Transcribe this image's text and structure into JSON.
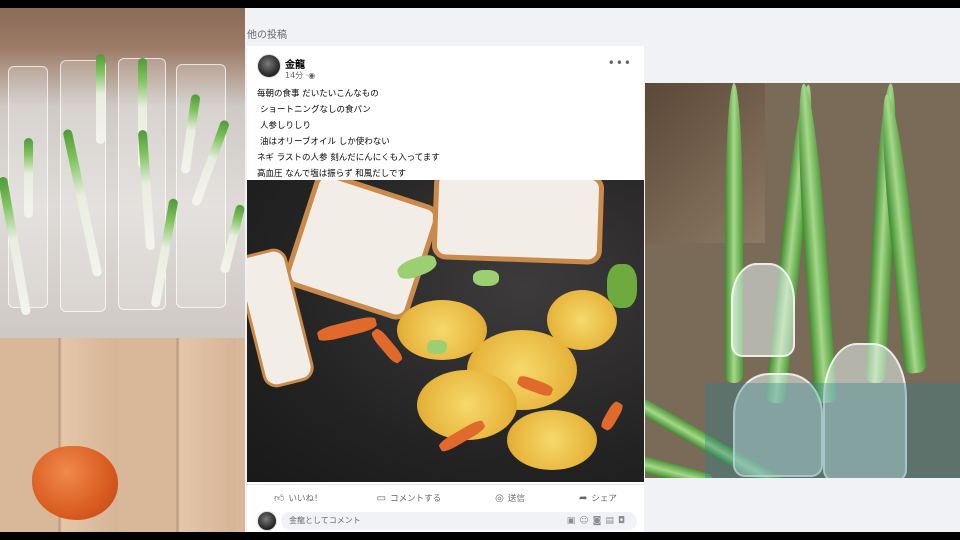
{
  "feed": {
    "section_label": "他の投稿"
  },
  "post": {
    "author": "金龍",
    "time": "14分",
    "privacy_icon": "globe-icon",
    "more_icon": "more-horizontal-icon",
    "lines": [
      "毎朝の食事 だいたいこんなもの",
      "ショートニングなしの食パン",
      "人参しりしり",
      "油はオリーブオイル しか使わない",
      "ネギ ラストの人参 刻んだにんにくも入ってます",
      "高血圧 なんで塩は振らず 和風だしです"
    ],
    "photo_alt": "food-photo",
    "actions": {
      "like": "いいね！",
      "comment": "コメントする",
      "send": "送信",
      "share": "シェア"
    },
    "comment_placeholder": "金龍としてコメント",
    "comment_tool_icons": [
      "sticker-icon",
      "emoji-icon",
      "camera-icon",
      "gif-icon",
      "avatar-sticker-icon"
    ]
  }
}
